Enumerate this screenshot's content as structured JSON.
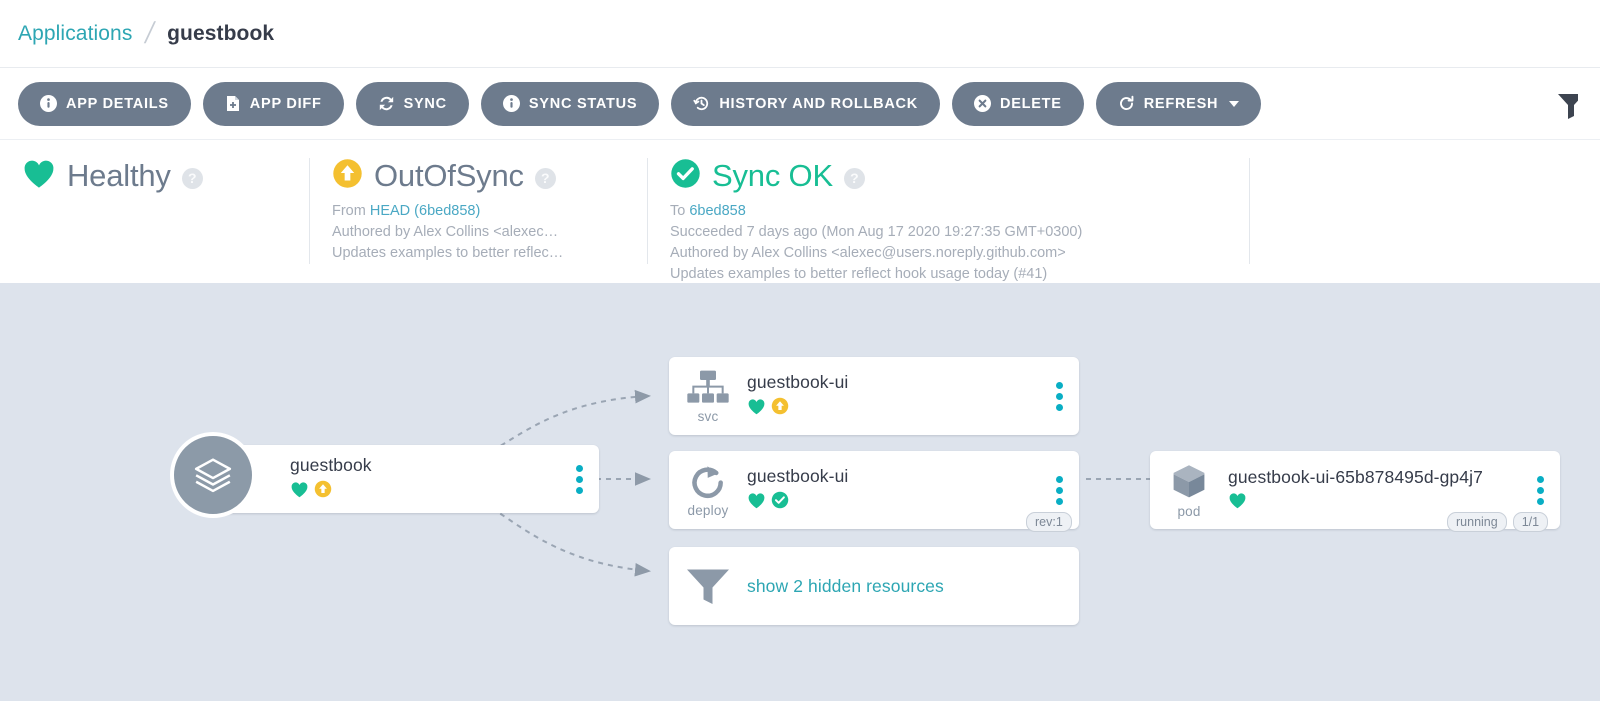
{
  "breadcrumb": {
    "root": "Applications",
    "separator": "/",
    "current": "guestbook"
  },
  "toolbar": {
    "buttons": [
      {
        "label": "APP DETAILS",
        "icon": "info-icon"
      },
      {
        "label": "APP DIFF",
        "icon": "file-diff-icon"
      },
      {
        "label": "SYNC",
        "icon": "sync-icon"
      },
      {
        "label": "SYNC STATUS",
        "icon": "info-icon"
      },
      {
        "label": "HISTORY AND ROLLBACK",
        "icon": "history-icon"
      },
      {
        "label": "DELETE",
        "icon": "close-circle-icon"
      },
      {
        "label": "REFRESH",
        "icon": "refresh-icon",
        "caret": true
      }
    ],
    "filter_icon": "filter-icon"
  },
  "status": {
    "health": {
      "title": "Healthy",
      "icon": "heart-icon",
      "help": "?"
    },
    "sync": {
      "title": "OutOfSync",
      "icon": "arrow-up-circle-icon",
      "help": "?",
      "from_label": "From ",
      "from_revision": "HEAD (6bed858)",
      "author": "Authored by Alex Collins <alexec…",
      "message": "Updates examples to better reflec…"
    },
    "operation": {
      "title": "Sync OK",
      "icon": "check-circle-icon",
      "help": "?",
      "to_label": "To ",
      "to_revision": "6bed858",
      "succeeded": "Succeeded 7 days ago (Mon Aug 17 2020 19:27:35 GMT+0300)",
      "author": "Authored by Alex Collins <alexec@users.noreply.github.com>",
      "message": "Updates examples to better reflect hook usage today (#41)"
    }
  },
  "graph": {
    "app_node": {
      "name": "guestbook",
      "icon": "layers-icon",
      "badges": [
        "heart-icon",
        "arrow-up-circle-icon"
      ],
      "menu": "kebab-menu-icon"
    },
    "nodes": [
      {
        "kind": "svc",
        "name": "guestbook-ui",
        "icon": "sitemap-icon",
        "badges": [
          "heart-icon",
          "arrow-up-circle-icon"
        ],
        "pills": [],
        "menu": "kebab-menu-icon"
      },
      {
        "kind": "deploy",
        "name": "guestbook-ui",
        "icon": "rotate-icon",
        "badges": [
          "heart-icon",
          "check-circle-icon"
        ],
        "pills": [
          "rev:1"
        ],
        "menu": "kebab-menu-icon"
      },
      {
        "kind": "pod",
        "name": "guestbook-ui-65b878495d-gp4j7",
        "icon": "cube-icon",
        "badges": [
          "heart-icon"
        ],
        "pills": [
          "running",
          "1/1"
        ],
        "menu": "kebab-menu-icon"
      }
    ],
    "hidden_resources": {
      "label": "show 2 hidden resources",
      "icon": "filter-icon"
    }
  },
  "colors": {
    "accent_teal": "#2da6b3",
    "healthy_green": "#18be94",
    "out_of_sync_yellow": "#f4c030",
    "button_grey": "#6d7b8d",
    "canvas": "#dde3ec"
  }
}
